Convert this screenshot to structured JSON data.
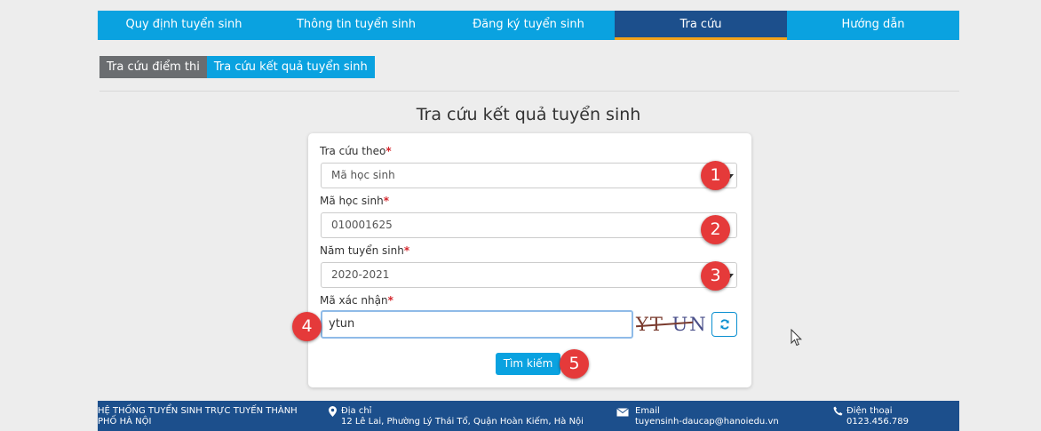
{
  "nav": {
    "items": [
      {
        "label": "Quy định tuyển sinh"
      },
      {
        "label": "Thông tin tuyển sinh"
      },
      {
        "label": "Đăng ký tuyển sinh"
      },
      {
        "label": "Tra cứu"
      },
      {
        "label": "Hướng dẫn"
      }
    ],
    "active_index": 3
  },
  "subtabs": {
    "exam_scores": "Tra cứu điểm thi",
    "admission_results": "Tra cứu kết quả tuyển sinh"
  },
  "page": {
    "title": "Tra cứu kết quả tuyển sinh"
  },
  "form": {
    "lookup_by": {
      "label": "Tra cứu theo",
      "value": "Mã học sinh"
    },
    "student_code": {
      "label": "Mã học sinh",
      "value": "010001625"
    },
    "admission_year": {
      "label": "Năm tuyển sinh",
      "value": "2020-2021"
    },
    "captcha": {
      "label": "Mã xác nhận",
      "value": "ytun",
      "image_text_a": "YT",
      "image_text_b": "UN"
    },
    "required_mark": "*",
    "submit_label": "Tìm kiếm"
  },
  "markers": [
    "1",
    "2",
    "3",
    "4",
    "5"
  ],
  "footer": {
    "org": "HỆ THỐNG TUYỂN SINH TRỰC TUYẾN THÀNH PHỐ HÀ NỘI",
    "address_label": "Địa chỉ",
    "address": "12 Lê Lai, Phường Lý Thái Tổ, Quận Hoàn Kiếm, Hà Nội",
    "email_label": "Email",
    "email": "tuyensinh-daucap@hanoiedu.vn",
    "phone_label": "Điện thoại",
    "phone": "0123.456.789"
  },
  "colors": {
    "nav_bg": "#0aa2e0",
    "nav_active": "#1c4f8c",
    "nav_active_underline": "#f2a31a",
    "footer_bg": "#1c4f8c",
    "marker": "#e53a3a",
    "required": "#d4262c"
  },
  "icons": [
    "map-pin-icon",
    "envelope-icon",
    "phone-icon",
    "refresh-icon",
    "mouse-cursor-icon",
    "dropdown-caret-icon"
  ]
}
